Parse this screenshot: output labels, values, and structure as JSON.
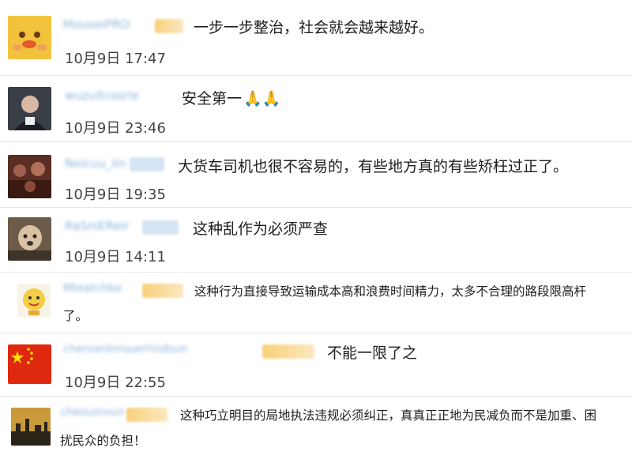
{
  "comments": [
    {
      "username": "MouseiPRO",
      "badge": "gold",
      "text": "一步一步整治，社会就会越来越好。",
      "date": "10月9日 17:47"
    },
    {
      "username": "wuzuitcosrie",
      "badge": "none",
      "text": "安全第一",
      "emoji": "🙏🙏",
      "date": "10月9日 23:46"
    },
    {
      "username": "Neicuu_lin",
      "badge": "blue",
      "text": "大货车司机也很不容易的，有些地方真的有些矫枉过正了。",
      "date": "10月9日 19:35"
    },
    {
      "username": "RaSniEReir",
      "badge": "blue",
      "text": "这种乱作为必须严查",
      "date": "10月9日 14:11"
    },
    {
      "username": "Mteatchbo",
      "badge": "gold",
      "text": "这种行为直接导致运输成本高和浪费时间精力，太多不合理的路段限高杆",
      "text2": "了。",
      "date": ""
    },
    {
      "username": "chenianlnrouerrindsun",
      "badge": "gold",
      "text": "不能一限了之",
      "date": "10月9日 22:55"
    },
    {
      "username": "cheouinvun",
      "badge": "gold",
      "text": "这种巧立明目的局地执法违规必须纠正，真真正正地为民减负而不是加重、困",
      "text2": "扰民众的负担！",
      "date": ""
    }
  ]
}
